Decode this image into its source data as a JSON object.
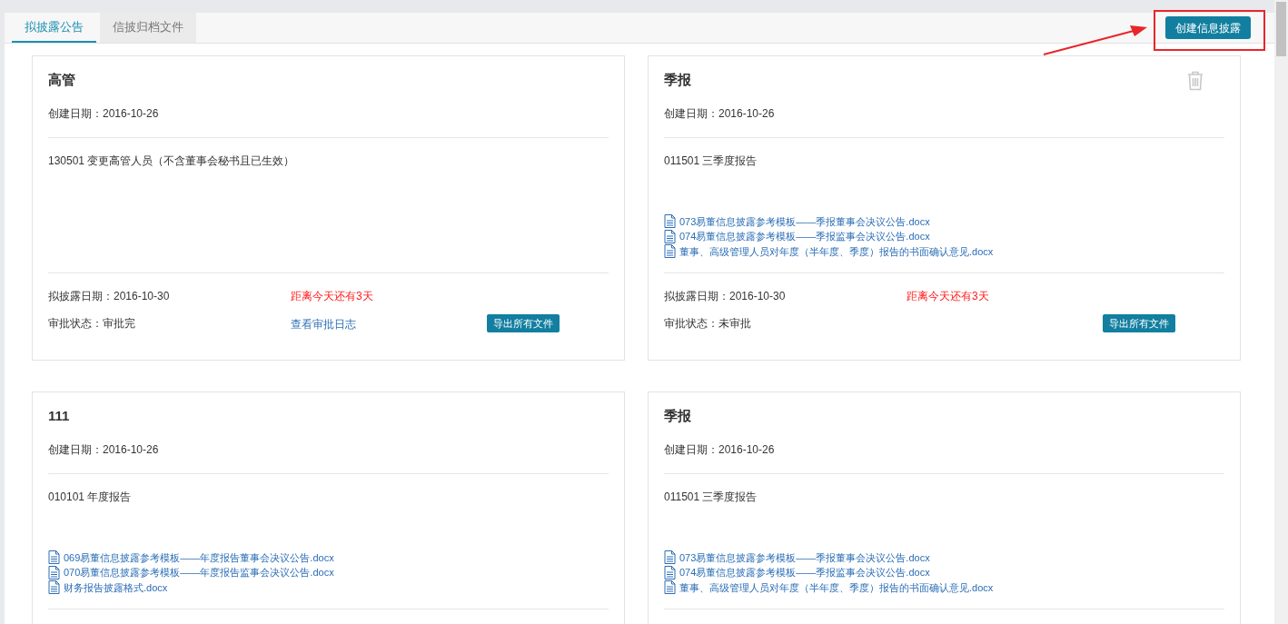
{
  "tabs": [
    {
      "label": "拟披露公告",
      "selected": true
    },
    {
      "label": "信披归档文件",
      "selected": false
    }
  ],
  "create_button": "创建信息披露",
  "annotation": {
    "highlight": true
  },
  "cards": [
    {
      "title": "高管",
      "deletable": false,
      "created": "创建日期：2016-10-26",
      "description": "130501 变更高管人员（不含董事会秘书且已生效）",
      "publish_date": "拟披露日期：2016-10-30",
      "countdown": "距离今天还有3天",
      "status": "审批状态：审批完",
      "log_link": "查看审批日志",
      "export_button": "导出所有文件"
    },
    {
      "title": "季报",
      "deletable": true,
      "created": "创建日期：2016-10-26",
      "description": "011501 三季度报告",
      "files": [
        "073易董信息披露参考模板——季报董事会决议公告.docx",
        "074易董信息披露参考模板——季报监事会决议公告.docx",
        "董事、高级管理人员对年度（半年度、季度）报告的书面确认意见.docx"
      ],
      "publish_date": "拟披露日期：2016-10-30",
      "countdown": "距离今天还有3天",
      "status": "审批状态：未审批",
      "export_button": "导出所有文件"
    },
    {
      "title": "111",
      "deletable": false,
      "created": "创建日期：2016-10-26",
      "description": "010101 年度报告",
      "files": [
        "069易董信息披露参考模板——年度报告董事会决议公告.docx",
        "070易董信息披露参考模板——年度报告监事会决议公告.docx",
        "财务报告披露格式.docx"
      ]
    },
    {
      "title": "季报",
      "deletable": false,
      "created": "创建日期：2016-10-26",
      "description": "011501 三季度报告",
      "files": [
        "073易董信息披露参考模板——季报董事会决议公告.docx",
        "074易董信息披露参考模板——季报监事会决议公告.docx",
        "董事、高级管理人员对年度（半年度、季度）报告的书面确认意见.docx"
      ]
    }
  ]
}
